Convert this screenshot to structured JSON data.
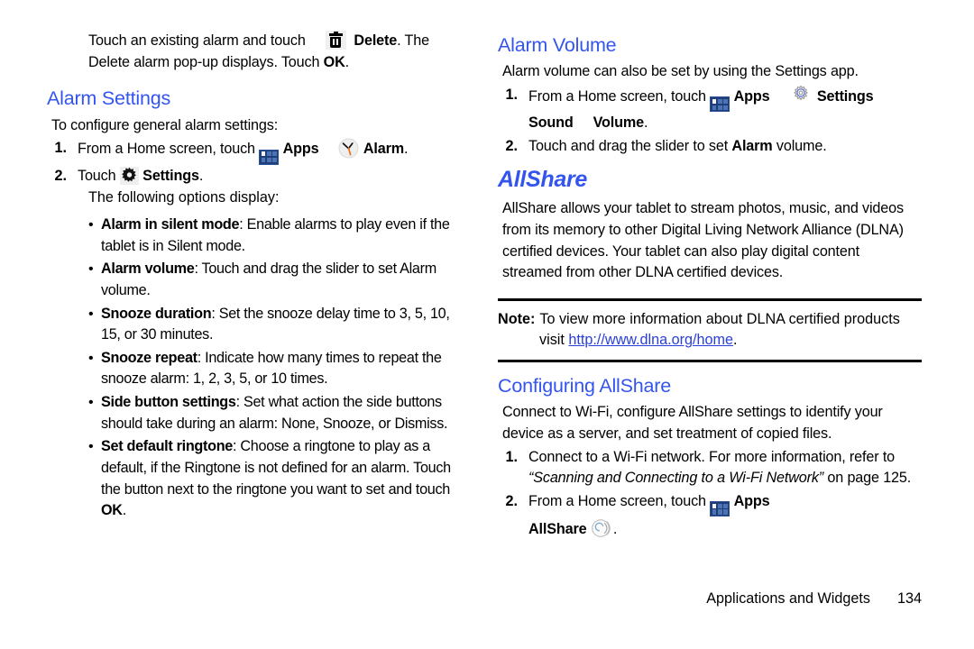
{
  "document": {
    "type": "user-manual-page",
    "heading_color": "#3355ee",
    "link_color": "#2a3fd8"
  },
  "left_column": {
    "intro": {
      "text_before_icon": "Touch an existing alarm and touch",
      "icon": "trash-icon",
      "bold_after_icon": "Delete",
      "text_after": ". The Delete alarm pop-up displays. Touch ",
      "bold_ok": "OK",
      "period": "."
    },
    "alarm_settings": {
      "heading": "Alarm Settings",
      "intro": "To configure general alarm settings:",
      "steps": [
        {
          "num": "1.",
          "pre": "From a Home screen, touch",
          "apps_icon": "apps-grid-icon",
          "apps_label": "Apps",
          "clock_icon": "clock-icon",
          "alarm_label": "Alarm",
          "end": "."
        },
        {
          "num": "2.",
          "pre": "Touch",
          "gear_icon": "gear-icon",
          "settings_label": "Settings",
          "end": "."
        }
      ],
      "following_options": "The following options display:",
      "bullets": [
        {
          "term": "Alarm in silent mode",
          "desc": ": Enable alarms to play even if the tablet is in Silent mode."
        },
        {
          "term": "Alarm volume",
          "desc": ": Touch and drag the slider to set Alarm volume."
        },
        {
          "term": "Snooze duration",
          "desc": ": Set the snooze delay time to 3, 5, 10, 15, or 30 minutes."
        },
        {
          "term": "Snooze repeat",
          "desc": ": Indicate how many times to repeat the snooze alarm: 1, 2, 3, 5, or 10 times."
        },
        {
          "term": "Side button settings",
          "desc": ": Set what action the side buttons should take during an alarm: None, Snooze, or Dismiss."
        },
        {
          "term": "Set default ringtone",
          "desc_part1": ": Choose a ringtone to play as a default, if the Ringtone is not defined for an alarm. Touch the button next to the ringtone you want to set and touch ",
          "desc_bold": "OK",
          "desc_part2": "."
        }
      ]
    }
  },
  "right_column": {
    "alarm_volume": {
      "heading": "Alarm Volume",
      "intro": "Alarm volume can also be set by using the Settings app.",
      "steps": [
        {
          "num": "1.",
          "pre": "From a Home screen, touch",
          "apps_icon": "apps-grid-icon",
          "apps_label": "Apps",
          "gear_icon": "gear-outline-icon",
          "settings_label": "Settings",
          "sub_sound": "Sound",
          "sub_volume": "Volume",
          "sub_end": "."
        },
        {
          "num": "2.",
          "pre": "Touch and drag the slider to set ",
          "bold": "Alarm",
          "post": " volume."
        }
      ]
    },
    "allshare": {
      "heading": "AllShare",
      "body": "AllShare allows your tablet to stream photos, music, and videos from its memory to other Digital Living Network Alliance (DLNA) certified devices. Your tablet can also play digital content streamed from other DLNA certified devices."
    },
    "note": {
      "label": "Note:",
      "text": "To view more information about DLNA certified products",
      "visit_word": "visit",
      "link": "http://www.dlna.org/home",
      "period": "."
    },
    "configuring_allshare": {
      "heading": "Configuring AllShare",
      "intro": "Connect to Wi-Fi, configure AllShare settings to identify your device as a server, and set treatment of copied files.",
      "steps": [
        {
          "num": "1.",
          "pre": "Connect to a Wi-Fi network. For more information, refer to ",
          "italic": "“Scanning and Connecting to a Wi-Fi Network”",
          "post": " on page 125."
        },
        {
          "num": "2.",
          "pre": "From a Home screen, touch",
          "apps_icon": "apps-grid-icon",
          "apps_label": "Apps",
          "allshare_label": "AllShare",
          "allshare_icon": "allshare-icon",
          "end": "."
        }
      ]
    }
  },
  "footer": {
    "title": "Applications and Widgets",
    "page_number": "134"
  }
}
